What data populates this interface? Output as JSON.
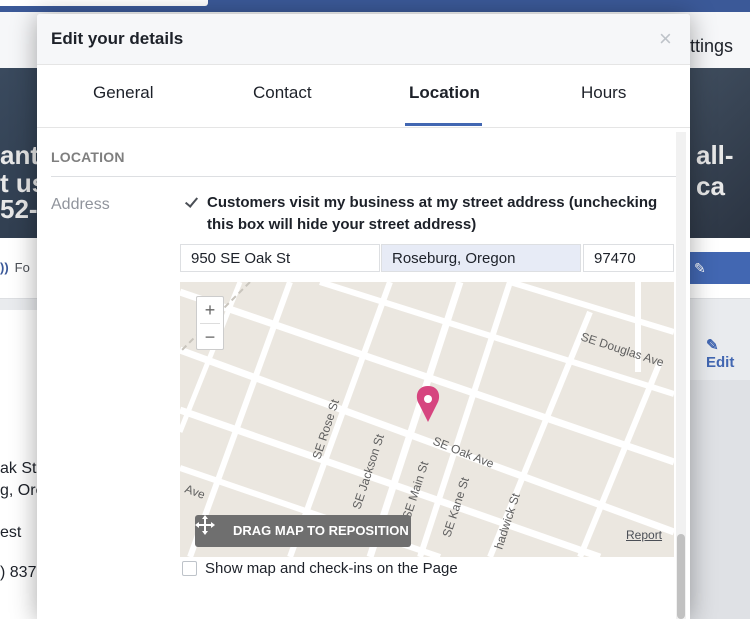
{
  "background": {
    "nav_settings": "ttings",
    "cover_left_lines": [
      "ant",
      "t us",
      "52-"
    ],
    "cover_right": "all-ca",
    "tabs_follow": "Fo",
    "edit_link": "Edit",
    "left_text": [
      "ak St",
      "g, Ore",
      "est",
      ") 837"
    ]
  },
  "modal": {
    "title": "Edit your details",
    "close": "×",
    "tabs": [
      {
        "label": "General"
      },
      {
        "label": "Contact"
      },
      {
        "label": "Location"
      },
      {
        "label": "Hours"
      }
    ],
    "active_tab": "Location",
    "section_label": "LOCATION",
    "address_label": "Address",
    "visit_checkbox_label": "Customers visit my business at my street address (unchecking this box will hide your street address)",
    "street": "950 SE Oak St",
    "city": "Roseburg, Oregon",
    "zip": "97470",
    "map": {
      "zoom_in": "+",
      "zoom_out": "−",
      "drag_label": "DRAG MAP TO REPOSITION",
      "report": "Report",
      "streets": [
        "SE Douglas Ave",
        "SE Rose St",
        "SE Jackson St",
        "SE Main St",
        "SE Oak Ave",
        "SE Kane St",
        "hadwick St",
        "Ave"
      ]
    },
    "show_map_label": "Show map and check-ins on the Page"
  },
  "colors": {
    "accent": "#4267b2",
    "marker": "#d6457f",
    "map_bg": "#ebe7e0"
  }
}
